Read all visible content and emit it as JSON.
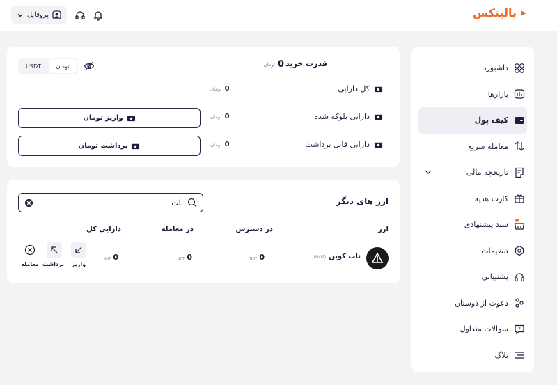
{
  "header": {
    "logo_text": "بالینکس",
    "profile_label": "پروفایل"
  },
  "sidebar": {
    "items": [
      {
        "label": "داشبورد"
      },
      {
        "label": "بازارها"
      },
      {
        "label": "کیف پول"
      },
      {
        "label": "معامله سریع"
      },
      {
        "label": "تاریخچه مالی"
      },
      {
        "label": "کارت هدیه"
      },
      {
        "label": "سبد پیشنهادی"
      },
      {
        "label": "تنظیمات"
      },
      {
        "label": "پشتیبانی"
      },
      {
        "label": "دعوت از دوستان"
      },
      {
        "label": "سوالات متداول"
      },
      {
        "label": "بلاگ"
      }
    ]
  },
  "wallet": {
    "buying_power_label": "قدرت خرید",
    "buying_power_value": "0",
    "currency_unit": "تومان",
    "toggle": {
      "toman": "تومان",
      "usdt": "USDT"
    },
    "total_assets_label": "کل دارایی",
    "total_assets_value": "0",
    "blocked_assets_label": "دارایی بلوکه شده",
    "blocked_assets_value": "0",
    "withdrawable_assets_label": "دارایی قابل برداشت",
    "withdrawable_assets_value": "0",
    "deposit_toman_label": "واریز تومان",
    "withdraw_toman_label": "برداشت تومان"
  },
  "others": {
    "title": "ارز های دیگر",
    "search_value": "نات",
    "columns": [
      "ارز",
      "در دسترس",
      "در معامله",
      "دارایی کل"
    ],
    "rows": [
      {
        "name": "نات کوین",
        "symbol": "(NOT)",
        "available": "0",
        "in_trade": "0",
        "total": "0",
        "unit": "NOT"
      }
    ],
    "actions": {
      "deposit": "واریز",
      "withdraw": "برداشت",
      "trade": "معامله"
    }
  }
}
